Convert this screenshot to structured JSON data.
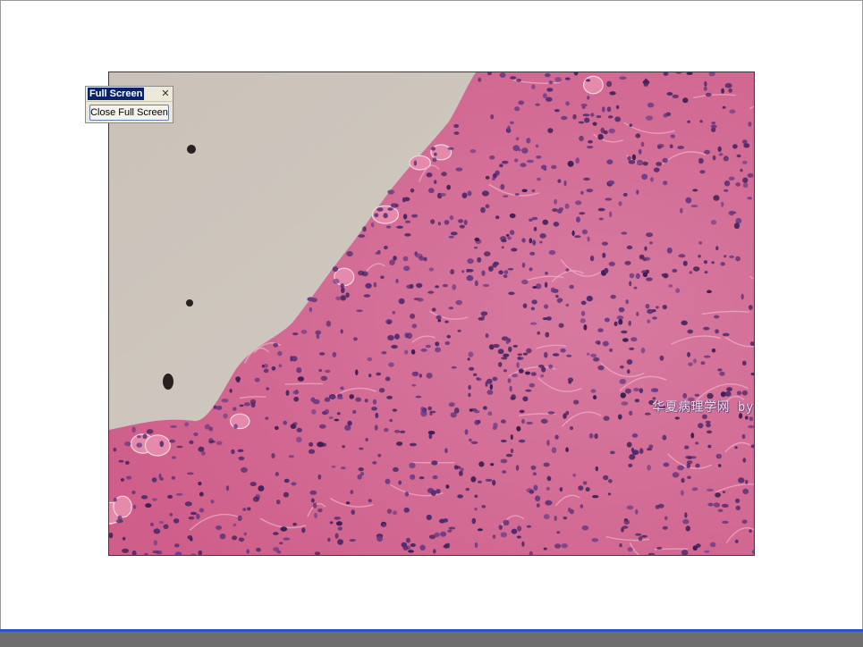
{
  "fullscreen_toolbar": {
    "title": "Full Screen",
    "close_icon": "close-icon",
    "button_label": "Close Full Screen"
  },
  "viewer": {
    "watermark": "华夏病理学网 by hyfhql",
    "image_subject": "H&E stained histology micrograph"
  },
  "colors": {
    "background_fluid": "#cfc8bf",
    "tissue_pink": "#d96a93",
    "nuclei_purple": "#5a2f78",
    "taskbar_accent": "#2a58c6",
    "taskbar": "#6e6e6e"
  }
}
